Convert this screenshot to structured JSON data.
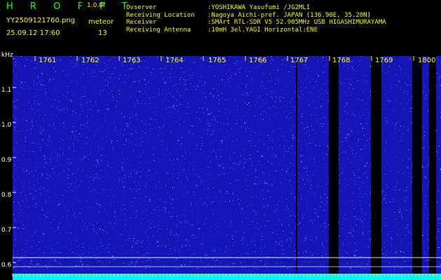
{
  "header": {
    "logo": "H R O F F T",
    "version": "1.0.0f",
    "filename": "YY2509121760.png",
    "datetime": "25.09.12 17:60",
    "meteor_label": "meteor",
    "meteor_count": "13",
    "fields": [
      {
        "label": "Ovserver",
        "value": ":YOSHIKAWA Yasufumi /JG2MLI"
      },
      {
        "label": "Receiving Location",
        "value": ":Nagoya Aichi-pref. JAPAN (136.90E, 35.20N)"
      },
      {
        "label": "Receiver",
        "value": ":SMArt RTL-SDR V5 52.905MHz USB HIGASHIMURAYAMA"
      },
      {
        "label": "Receiving Antenna",
        "value": ":10mH 3el.YAGI Horizontal:ENE"
      }
    ]
  },
  "spectrogram": {
    "y_unit": "kHz",
    "y_ticks": [
      "1.1",
      "1.0",
      "0.9",
      "0.8",
      "0.7",
      "0.6"
    ],
    "time_labels": [
      "1761",
      "1762",
      "1763",
      "1764",
      "1765",
      "1766",
      "1767",
      "1768",
      "1769",
      "1800"
    ],
    "colors": {
      "background": "#1515b8",
      "noise": "#4a65ff",
      "signal": "#ffffff",
      "bottom_band": "#00f5ff",
      "gap": "#000000",
      "tick": "#ffff00",
      "grid": "#ffffff"
    }
  }
}
